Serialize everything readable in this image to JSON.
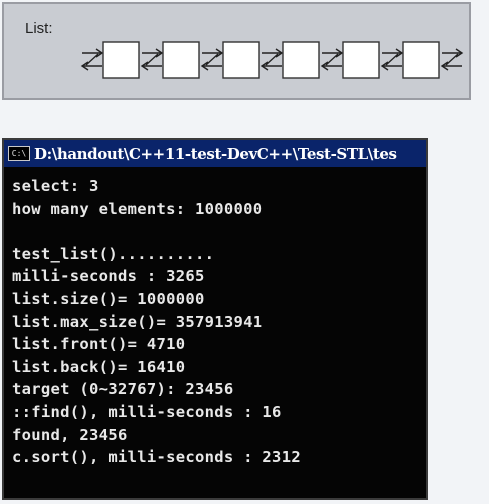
{
  "diagram": {
    "label": "List:",
    "node_count": 6
  },
  "console": {
    "title": "D:\\handout\\C++11-test-DevC++\\Test-STL\\tes",
    "icon": "cmd-icon",
    "lines": [
      "select: 3",
      "how many elements: 1000000",
      "",
      "test_list()..........",
      "milli-seconds : 3265",
      "list.size()= 1000000",
      "list.max_size()= 357913941",
      "list.front()= 4710",
      "list.back()= 16410",
      "target (0~32767): 23456",
      "::find(), milli-seconds : 16",
      "found, 23456",
      "c.sort(), milli-seconds : 2312"
    ]
  },
  "colors": {
    "titlebar": "#0a246a",
    "console_bg": "#050505",
    "console_text": "#e8e8e8",
    "diagram_bg": "#c9ccd2"
  }
}
